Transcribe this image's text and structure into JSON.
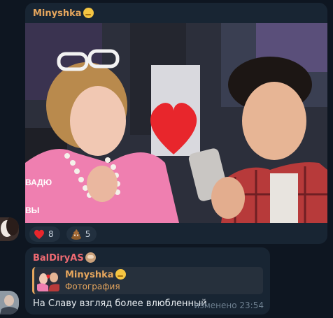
{
  "post": {
    "sender": "Minyshka",
    "sender_emoji": "relieved-face-emoji",
    "photo_caption_fragments": [
      "ВАДЮ",
      "ВЫ"
    ],
    "reactions": [
      {
        "icon": "red-heart-icon",
        "count": "8"
      },
      {
        "icon": "poop-emoji-icon",
        "count": "5"
      }
    ]
  },
  "reply_message": {
    "sender": "BalDiryAS",
    "sender_emoji": "see-no-evil-monkey-emoji",
    "quoted": {
      "author": "Minyshka",
      "type_label": "Фотография"
    },
    "text": "На Славу взгляд более влюбленный",
    "edited_label": "изменено",
    "time": "23:54"
  },
  "colors": {
    "background": "#0e1621",
    "bubble": "#182533",
    "accent_orange": "#e6a65d",
    "accent_red": "#ef6a72"
  }
}
